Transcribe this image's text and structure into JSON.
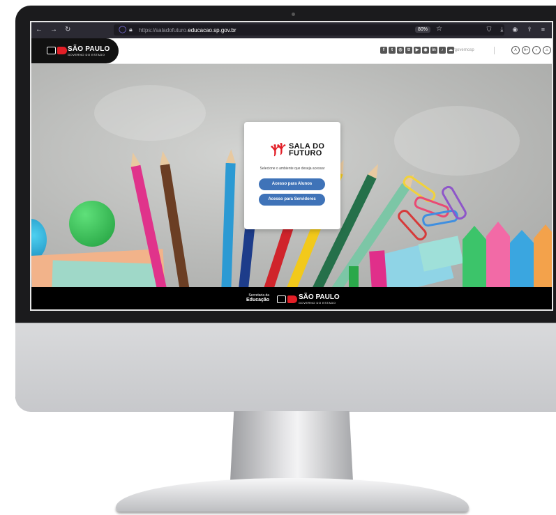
{
  "browser": {
    "url_prefix": "https://saladofuturo.",
    "url_domain": "educacao.sp.gov.br",
    "zoom": "80%",
    "icons": [
      "back-icon",
      "forward-icon",
      "reload-icon",
      "shield-icon",
      "lock-icon",
      "star-icon",
      "pocket-icon",
      "download-icon",
      "account-icon",
      "share-icon",
      "menu-icon"
    ]
  },
  "header": {
    "logo_word": "SÃO PAULO",
    "logo_sub": "GOVERNO DO ESTADO",
    "social_glyphs": [
      "f",
      "t",
      "◎",
      "tt",
      "▶",
      "◉",
      "in",
      "♪",
      "☁"
    ],
    "social_handle": "/governosp",
    "accessibility_glyphs": [
      "A",
      "A+",
      "◐",
      "⚠"
    ]
  },
  "card": {
    "brand_line1": "SALA DO",
    "brand_line2": "FUTURO",
    "prompt": "Selecione o ambiente que deseja acessar",
    "btn_alunos": "Acesso para Alunos",
    "btn_servidores": "Acesso para Servidores"
  },
  "footer": {
    "secretaria_line1": "Secretaria da",
    "secretaria_line2": "Educação",
    "logo_word": "SÃO PAULO",
    "logo_sub": "GOVERNO DO ESTADO"
  },
  "colors": {
    "accent_blue": "#3f73b8",
    "brand_red": "#e21e26",
    "chrome_dark": "#2b2a33"
  }
}
